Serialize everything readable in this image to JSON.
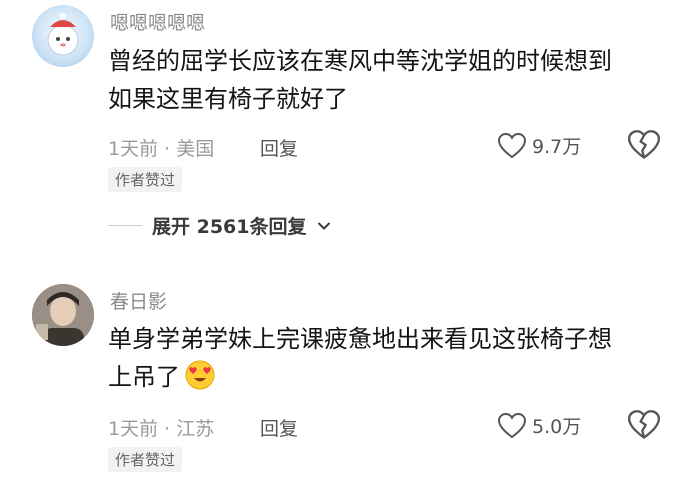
{
  "comments": [
    {
      "username": "嗯嗯嗯嗯嗯",
      "text_line1": "曾经的屈学长应该在寒风中等沈学姐的时候想到",
      "text_line2": "如果这里有椅子就好了",
      "meta": "1天前 · 美国",
      "reply_label": "回复",
      "likes": "9.7万",
      "badge": "作者赞过",
      "avatar_icon": "snowman-character-avatar"
    },
    {
      "username": "春日影",
      "text_line1": "单身学弟学妹上完课疲惫地出来看见这张椅子想",
      "text_line2": "上吊了",
      "meta": "1天前 · 江苏",
      "reply_label": "回复",
      "likes": "5.0万",
      "badge": "作者赞过",
      "avatar_icon": "person-photo-avatar",
      "emoji": "heart-eyes-emoji"
    }
  ],
  "expand_replies": {
    "label": "展开 2561条回复"
  },
  "colors": {
    "text": "#141414",
    "meta": "#9a9a9a",
    "badge_bg": "#f2f2f2"
  }
}
